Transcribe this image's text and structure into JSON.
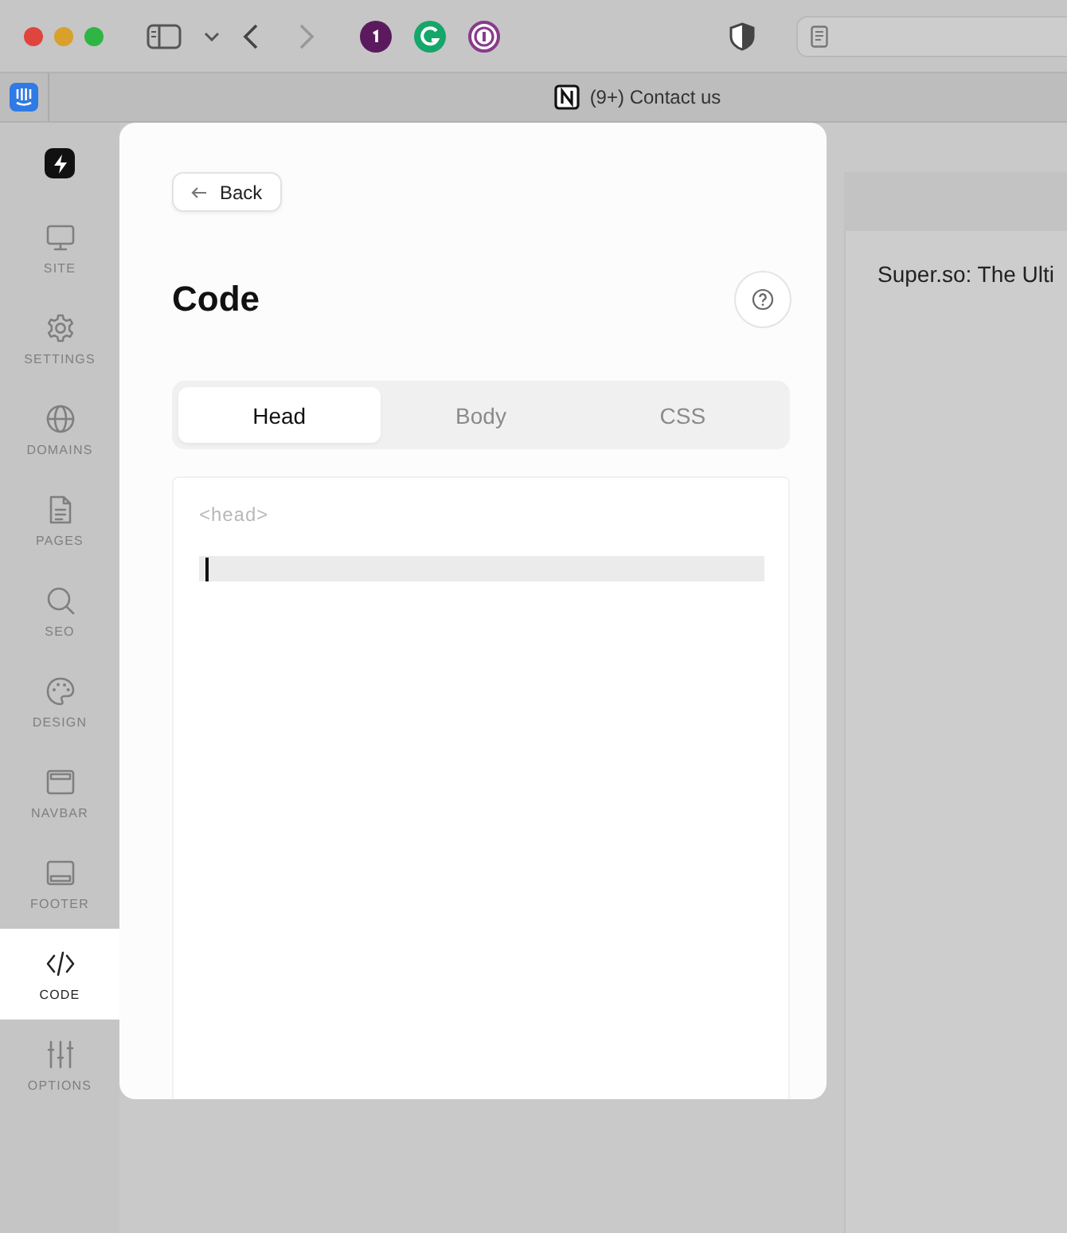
{
  "browser": {
    "tab_title": "(9+) Contact us"
  },
  "sidebar": {
    "items": [
      {
        "label": "SITE",
        "selected": false
      },
      {
        "label": "SETTINGS",
        "selected": false
      },
      {
        "label": "DOMAINS",
        "selected": false
      },
      {
        "label": "PAGES",
        "selected": false
      },
      {
        "label": "SEO",
        "selected": false
      },
      {
        "label": "DESIGN",
        "selected": false
      },
      {
        "label": "NAVBAR",
        "selected": false
      },
      {
        "label": "FOOTER",
        "selected": false
      },
      {
        "label": "CODE",
        "selected": true
      },
      {
        "label": "OPTIONS",
        "selected": false
      }
    ]
  },
  "panel": {
    "back_label": "Back",
    "title": "Code",
    "tabs": [
      {
        "label": "Head",
        "selected": true
      },
      {
        "label": "Body",
        "selected": false
      },
      {
        "label": "CSS",
        "selected": false
      }
    ],
    "editor": {
      "placeholder": "<head>"
    }
  },
  "preview": {
    "page_title": "Super.so: The Ulti"
  }
}
